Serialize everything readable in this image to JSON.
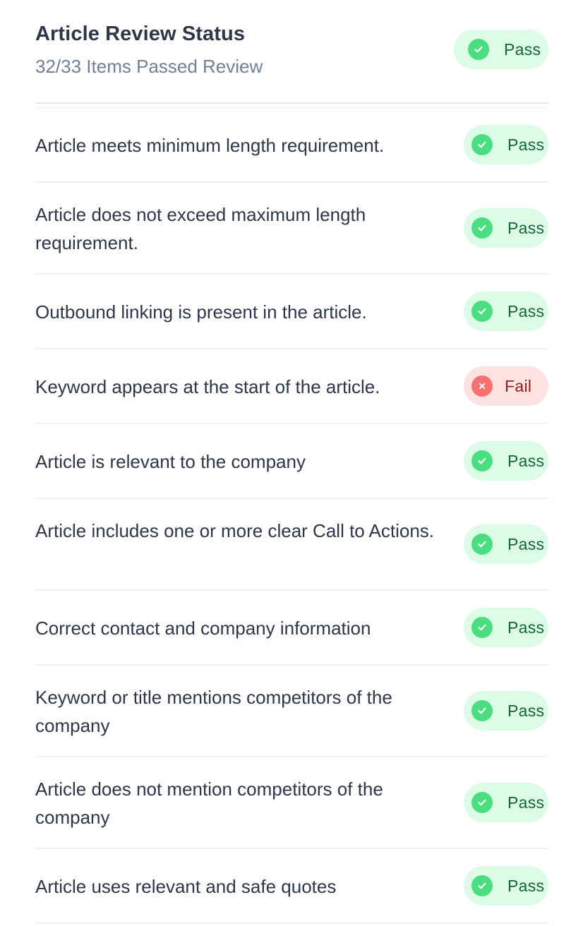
{
  "header": {
    "title": "Article Review Status",
    "subtitle": "32/33 Items Passed Review",
    "status": "Pass"
  },
  "colors": {
    "pass_bg": "#dcfce7",
    "pass_icon": "#4ade80",
    "pass_text": "#166534",
    "fail_bg": "#fee2e2",
    "fail_icon": "#f87171",
    "fail_text": "#991b1b"
  },
  "items": [
    {
      "text": "Article meets minimum length requirement.",
      "status": "Pass"
    },
    {
      "text": "Article does not exceed maximum length requirement.",
      "status": "Pass"
    },
    {
      "text": "Outbound linking is present in the article.",
      "status": "Pass"
    },
    {
      "text": "Keyword appears at the start of the article.",
      "status": "Fail"
    },
    {
      "text": "Article is relevant to the company",
      "status": "Pass"
    },
    {
      "text": "Article includes one or more clear Call to Actions.",
      "status": "Pass"
    },
    {
      "text": "Correct contact and company information",
      "status": "Pass"
    },
    {
      "text": "Keyword or title mentions competitors of the company",
      "status": "Pass"
    },
    {
      "text": "Article does not mention competitors of the company",
      "status": "Pass"
    },
    {
      "text": "Article uses relevant and safe quotes",
      "status": "Pass"
    }
  ]
}
